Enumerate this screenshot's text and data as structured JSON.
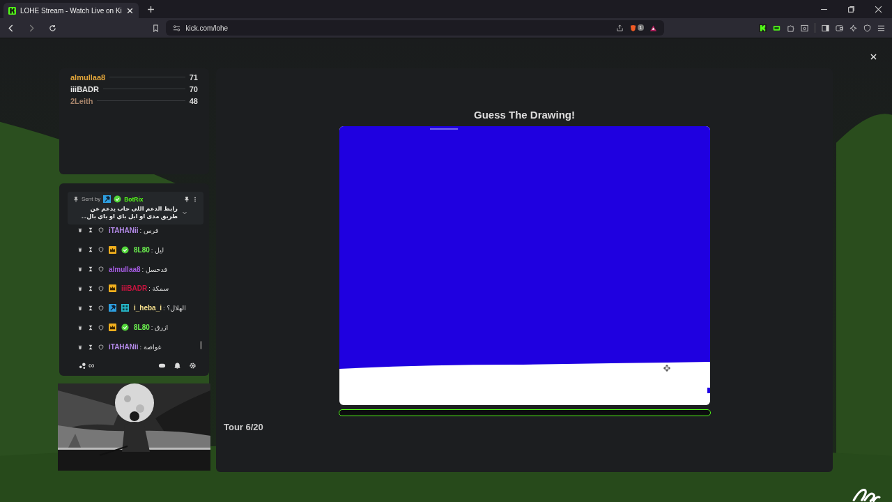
{
  "browser": {
    "tab_title": "LOHE Stream - Watch Live on Ki",
    "url": "kick.com/lohe",
    "shield_count": "1"
  },
  "leaderboard": [
    {
      "name": "almullaa8",
      "score": "71",
      "color": "#e0a43a"
    },
    {
      "name": "iiiBADR",
      "score": "70",
      "color": "#e8e8e8"
    },
    {
      "name": "2Leith",
      "score": "48",
      "color": "#a5836a"
    }
  ],
  "pinned": {
    "label": "Sent by",
    "badges": [
      {
        "kind": "hammer"
      },
      {
        "kind": "verified"
      }
    ],
    "user": "BotRix",
    "text": "رابط الدعم اللي حاب يدعم عن طريق مدى او ابل باي او باي بال..."
  },
  "messages": [
    {
      "user": "iTAHANii",
      "color": "#b48ae8",
      "text": ": فرس"
    },
    {
      "badges": [
        {
          "kind": "crown"
        },
        {
          "kind": "verified"
        }
      ],
      "user": "8L80",
      "color": "#6cf24f",
      "text": ": ليل"
    },
    {
      "user": "almullaa8",
      "color": "#a45be0",
      "text": ": قدحسل"
    },
    {
      "badges": [
        {
          "kind": "crown"
        }
      ],
      "user": "iiiBADR",
      "color": "#c8143f",
      "text": ": سمكة"
    },
    {
      "badges": [
        {
          "kind": "hammer"
        },
        {
          "kind": "og"
        }
      ],
      "user": "i_heba_i",
      "color": "#f5df8c",
      "text": ": الهلال؟"
    },
    {
      "badges": [
        {
          "kind": "crown"
        },
        {
          "kind": "verified"
        }
      ],
      "user": "8L80",
      "color": "#6cf24f",
      "text": ": ازرق"
    },
    {
      "user": "iTAHANii",
      "color": "#b48ae8",
      "text": ": غواصة"
    }
  ],
  "chat_footer": {
    "viewers": "∞"
  },
  "game": {
    "title": "Guess The Drawing!",
    "round": "Tour 6/20"
  }
}
